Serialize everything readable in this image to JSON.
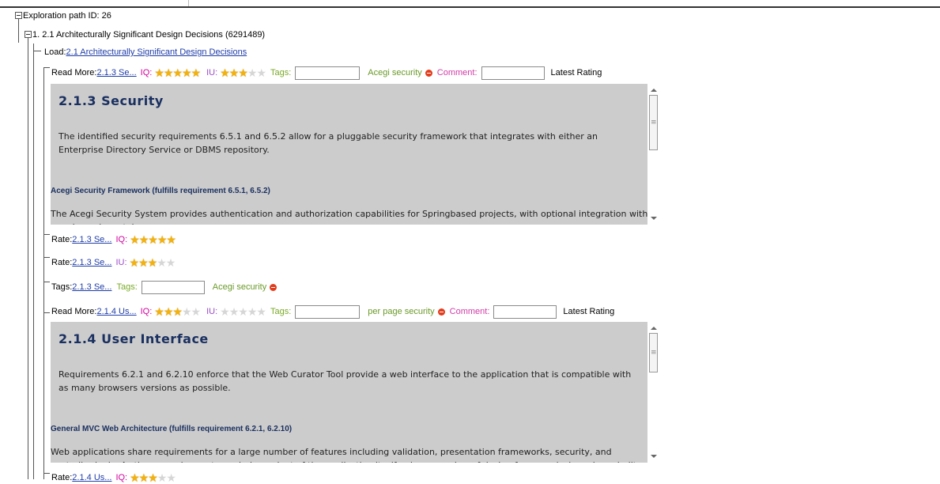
{
  "tree": {
    "root_label": "Exploration path ID: 26",
    "section_label": "1. 2.1 Architecturally Significant Design Decisions (6291489)",
    "load_prefix": "Load: ",
    "load_link": "2.1 Architecturally Significant Design Decisions"
  },
  "labels": {
    "read_more": "Read More: ",
    "rate": "Rate: ",
    "tags_prefix": "Tags: ",
    "iq": "IQ:",
    "iu": "IU:",
    "tags": "Tags:",
    "comment": "Comment:",
    "latest_rating": "Latest Rating"
  },
  "items": [
    {
      "link_text": "2.1.3 Se...",
      "iq_rating": 5,
      "iu_rating": 3,
      "tag": "Acegi security",
      "tag_input": "",
      "comment_input": "",
      "preview": {
        "heading": "2.1.3 Security",
        "paragraph": "The identified security requirements 6.5.1 and 6.5.2 allow for a pluggable security framework that integrates with either an Enterprise Directory Service or DBMS repository.",
        "subheading": "Acegi Security Framework (fulfills requirement 6.5.1, 6.5.2)",
        "body": "The Acegi Security System provides authentication and authorization capabilities for Springbased projects, with optional integration with popular web containers."
      },
      "tags_row_input": ""
    },
    {
      "link_text": "2.1.4 Us...",
      "iq_rating": 3,
      "iu_rating": 0,
      "tag": "per page security",
      "tag_input": "",
      "comment_input": "",
      "preview": {
        "heading": "2.1.4 User Interface",
        "paragraph": "Requirements 6.2.1 and 6.2.10 enforce that the Web Curator Tool provide a web interface to the application that is compatible with as many browsers versions as possible.",
        "subheading": "General MVC Web Architecture (fulfills requirement 6.2.1, 6.2.10)",
        "body": "Web applications share requirements for a large number of features including validation, presentation frameworks, security, and controller logic. As these requirements are independent of the application itself, a large number of design frameworks have been built."
      }
    }
  ],
  "icons": {
    "star": "star-icon",
    "remove": "minus-circle-icon",
    "collapse": "tree-collapse-icon"
  },
  "colors": {
    "link": "#1f3da8",
    "iq": "#d2009e",
    "iu": "#9b4ac9",
    "tags": "#7aaa28",
    "star": "#f2b20c",
    "remove": "#e33c1c",
    "preview_bg": "#cccccc"
  }
}
